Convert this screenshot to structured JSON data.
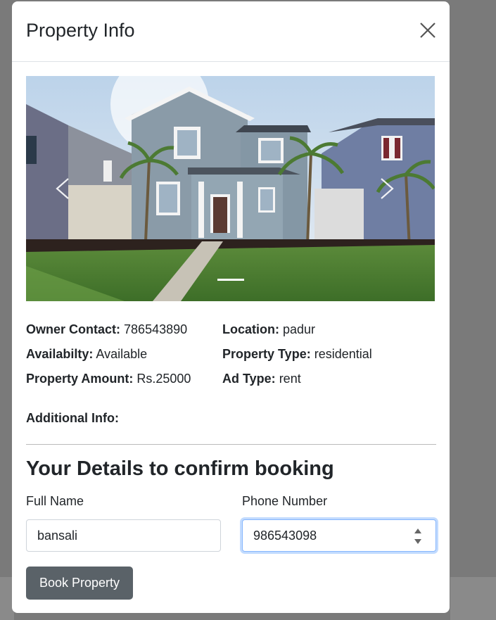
{
  "modal": {
    "title": "Property Info",
    "close_icon": "close-icon"
  },
  "carousel": {
    "image_alt": "Two-story grey house with lawn and palm trees",
    "prev_icon": "chevron-left-icon",
    "next_icon": "chevron-right-icon",
    "slide_count": 1,
    "active_slide": 1
  },
  "property": {
    "owner_contact_label": "Owner Contact:",
    "owner_contact_value": "786543890",
    "location_label": "Location:",
    "location_value": "padur",
    "availability_label": "Availabilty:",
    "availability_value": "Available",
    "property_type_label": "Property Type:",
    "property_type_value": "residential",
    "amount_label": "Property Amount:",
    "amount_value": "Rs.25000",
    "ad_type_label": "Ad Type:",
    "ad_type_value": "rent",
    "additional_info_label": "Additional Info:"
  },
  "booking": {
    "title": "Your Details to confirm booking",
    "full_name_label": "Full Name",
    "full_name_value": "bansali",
    "phone_label": "Phone Number",
    "phone_value": "986543098",
    "submit_label": "Book Property"
  }
}
